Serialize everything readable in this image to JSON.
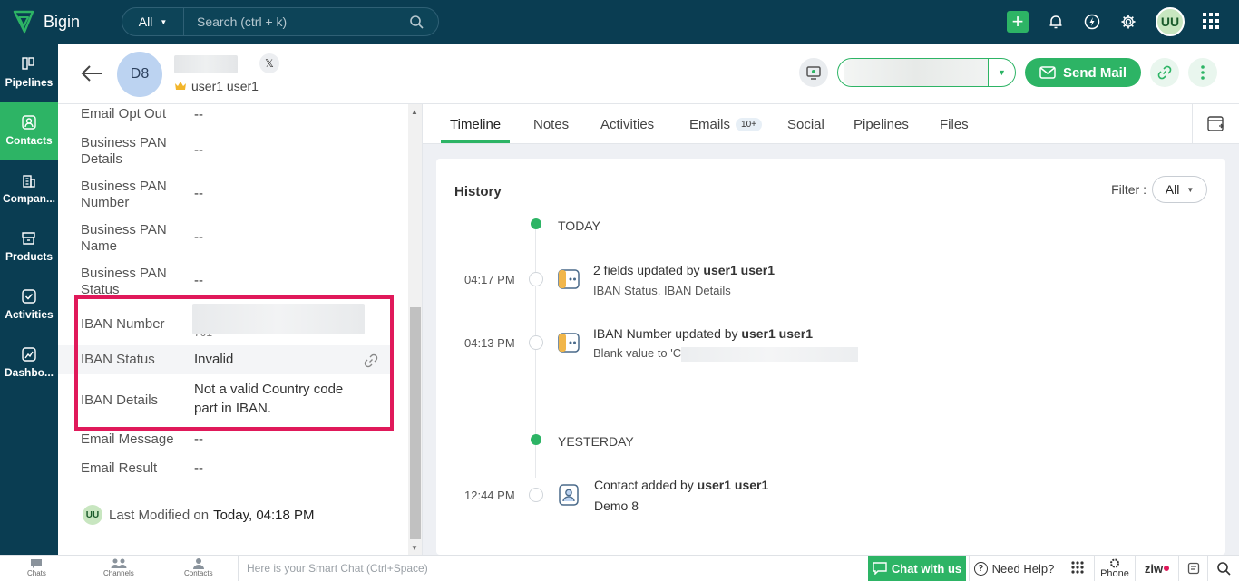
{
  "app": {
    "name": "Bigin"
  },
  "search": {
    "scope": "All",
    "placeholder": "Search (ctrl + k)"
  },
  "topbar": {
    "user_initials": "UU"
  },
  "sidebar": {
    "items": [
      {
        "label": "Pipelines",
        "icon": "pipelines-icon"
      },
      {
        "label": "Contacts",
        "icon": "contacts-icon",
        "active": true
      },
      {
        "label": "Compan...",
        "icon": "companies-icon"
      },
      {
        "label": "Products",
        "icon": "products-icon"
      },
      {
        "label": "Activities",
        "icon": "activities-icon"
      },
      {
        "label": "Dashbo...",
        "icon": "dashboards-icon"
      }
    ]
  },
  "record": {
    "avatar_initials": "D8",
    "owner": "user1 user1",
    "x_label": "𝕏"
  },
  "header_actions": {
    "send_mail": "Send Mail"
  },
  "details": {
    "rows": [
      {
        "label": "Email Opt Out",
        "value": "--"
      },
      {
        "label": "Business PAN Details",
        "value": "--"
      },
      {
        "label": "Business PAN Number",
        "value": "--"
      },
      {
        "label": "Business PAN Name",
        "value": "--"
      },
      {
        "label": "Business PAN Status",
        "value": "--"
      },
      {
        "label": "IBAN Number",
        "value": "701"
      },
      {
        "label": "IBAN Status",
        "value": "Invalid"
      },
      {
        "label": "IBAN Details",
        "value": "Not a valid Country code part in IBAN."
      },
      {
        "label": "Email Message",
        "value": "--"
      },
      {
        "label": "Email Result",
        "value": "--"
      }
    ],
    "last_modified": {
      "initials": "UU",
      "label": "Last Modified on",
      "when": "Today, 04:18 PM"
    }
  },
  "tabs": [
    {
      "label": "Timeline",
      "active": true
    },
    {
      "label": "Notes"
    },
    {
      "label": "Activities"
    },
    {
      "label": "Emails",
      "badge": "10+"
    },
    {
      "label": "Social"
    },
    {
      "label": "Pipelines"
    },
    {
      "label": "Files"
    }
  ],
  "history": {
    "title": "History",
    "filter_label": "Filter :",
    "filter_value": "All",
    "groups": [
      {
        "day": "TODAY",
        "entries": [
          {
            "time": "04:17 PM",
            "text": "2 fields updated by ",
            "user": "user1 user1",
            "sub": "IBAN Status, IBAN Details"
          },
          {
            "time": "04:13 PM",
            "text": "IBAN Number updated by ",
            "user": "user1 user1",
            "sub": "Blank value to 'C"
          }
        ]
      },
      {
        "day": "YESTERDAY",
        "entries": [
          {
            "time": "12:44 PM",
            "text": "Contact added by ",
            "user": "user1 user1",
            "sub": "Demo 8"
          }
        ]
      }
    ]
  },
  "bottombar": {
    "chats": "Chats",
    "channels": "Channels",
    "contacts": "Contacts",
    "smartchat_placeholder": "Here is your Smart Chat (Ctrl+Space)",
    "chat_with_us": "Chat with us",
    "need_help": "Need Help?",
    "phone": "Phone",
    "zia": "ziw"
  },
  "colors": {
    "brand_dark": "#0a3d52",
    "accent_green": "#2db465",
    "highlight_red": "#e0195a"
  }
}
